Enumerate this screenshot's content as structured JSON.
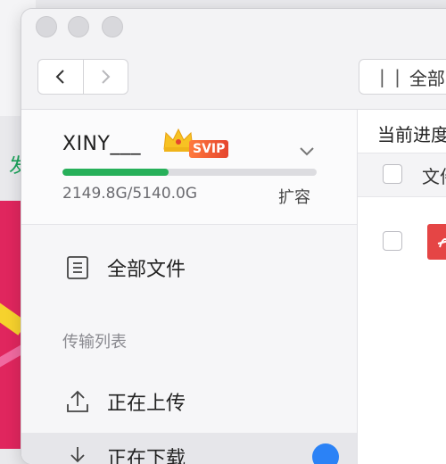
{
  "background": {
    "partial_text": "发"
  },
  "window": {
    "toolbar": {
      "back_label": "back",
      "forward_label": "forward",
      "all_button_label": "全部",
      "all_button_glyph": "| |"
    },
    "account": {
      "username": "XINY___",
      "badge": "SVIP",
      "quota_text": "2149.8G/5140.0G",
      "quota_fraction": 0.418,
      "expand_label": "扩容"
    },
    "sidebar": {
      "all_files": "全部文件",
      "transfer_header": "传输列表",
      "uploading": "正在上传",
      "downloading": "正在下载"
    },
    "main": {
      "progress_label": "当前进度",
      "file_column": "文件"
    }
  },
  "colors": {
    "accent_green": "#27b05a",
    "badge_orange": "#e5452f",
    "notify_blue": "#2b82f6",
    "pdf_red": "#e54545"
  }
}
